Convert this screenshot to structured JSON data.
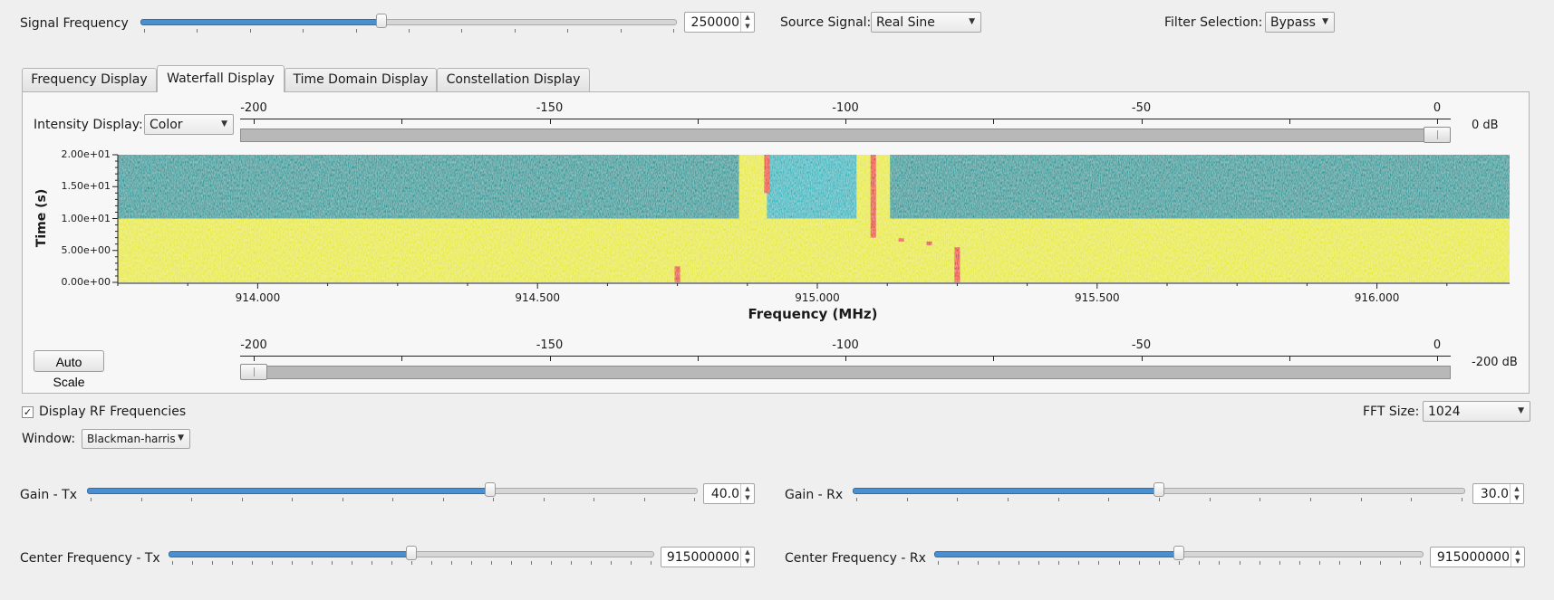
{
  "top_controls": {
    "signal_frequency": {
      "label": "Signal Frequency",
      "value": "250000",
      "slider_fraction": 0.45
    },
    "source_signal": {
      "label": "Source Signal:",
      "value": "Real Sine"
    },
    "filter_selection": {
      "label": "Filter Selection:",
      "value": "Bypass"
    }
  },
  "tabs": [
    {
      "label": "Frequency Display",
      "active": false
    },
    {
      "label": "Waterfall Display",
      "active": true
    },
    {
      "label": "Time Domain Display",
      "active": false
    },
    {
      "label": "Constellation Display",
      "active": false
    }
  ],
  "waterfall": {
    "intensity_label": "Intensity Display:",
    "intensity_mode": "Color",
    "upper_scale": {
      "ticks": [
        "-200",
        "-150",
        "-100",
        "-50",
        "0"
      ],
      "value_label": "0 dB",
      "value_db": 0
    },
    "lower_scale": {
      "ticks": [
        "-200",
        "-150",
        "-100",
        "-50",
        "0"
      ],
      "value_label": "-200 dB",
      "value_db": -200
    },
    "auto_scale_label": "Auto Scale",
    "ylabel": "Time (s)",
    "y_ticks": [
      "2.00e+01",
      "1.50e+01",
      "1.00e+01",
      "5.00e+00",
      "0.00e+00"
    ],
    "xlabel": "Frequency (MHz)",
    "x_ticks": [
      "914.000",
      "914.500",
      "915.000",
      "915.500",
      "916.000"
    ]
  },
  "chart_data": {
    "type": "heatmap",
    "title": "",
    "xlabel": "Frequency (MHz)",
    "ylabel": "Time (s)",
    "xlim": [
      913.75,
      916.25
    ],
    "ylim": [
      0,
      20
    ],
    "colors": {
      "low": "#0e9a9a",
      "mid": "#e8ea20",
      "high": "#e8401a"
    },
    "regions": [
      {
        "t": [
          10,
          20
        ],
        "f": [
          913.75,
          914.86
        ],
        "level": "low"
      },
      {
        "t": [
          10,
          20
        ],
        "f": [
          914.86,
          914.91
        ],
        "level": "mid"
      },
      {
        "t": [
          10,
          20
        ],
        "f": [
          914.91,
          915.07
        ],
        "level": "low-bright"
      },
      {
        "t": [
          10,
          20
        ],
        "f": [
          915.07,
          915.13
        ],
        "level": "mid"
      },
      {
        "t": [
          10,
          20
        ],
        "f": [
          915.13,
          916.25
        ],
        "level": "low"
      },
      {
        "t": [
          0,
          10
        ],
        "f": [
          913.75,
          916.25
        ],
        "level": "mid"
      }
    ],
    "hot_marks": [
      {
        "f": 914.91,
        "t": [
          14,
          20
        ]
      },
      {
        "f": 915.1,
        "t": [
          7,
          20
        ]
      },
      {
        "f": 915.15,
        "t": [
          6.4,
          6.9
        ]
      },
      {
        "f": 915.2,
        "t": [
          5.8,
          6.4
        ]
      },
      {
        "f": 915.25,
        "t": [
          0,
          5.5
        ]
      },
      {
        "f": 914.75,
        "t": [
          0,
          2.5
        ]
      }
    ]
  },
  "bottom_controls": {
    "display_rf": {
      "label": "Display RF Frequencies",
      "checked": true
    },
    "fft_size": {
      "label": "FFT Size:",
      "value": "1024"
    },
    "window": {
      "label": "Window:",
      "value": "Blackman-harris"
    },
    "gain_tx": {
      "label": "Gain - Tx",
      "value": "40.0",
      "slider_fraction": 0.66
    },
    "gain_rx": {
      "label": "Gain - Rx",
      "value": "30.0",
      "slider_fraction": 0.5
    },
    "center_tx": {
      "label": "Center Frequency - Tx",
      "value": "915000000",
      "slider_fraction": 0.5
    },
    "center_rx": {
      "label": "Center Frequency - Rx",
      "value": "915000000",
      "slider_fraction": 0.5
    }
  }
}
